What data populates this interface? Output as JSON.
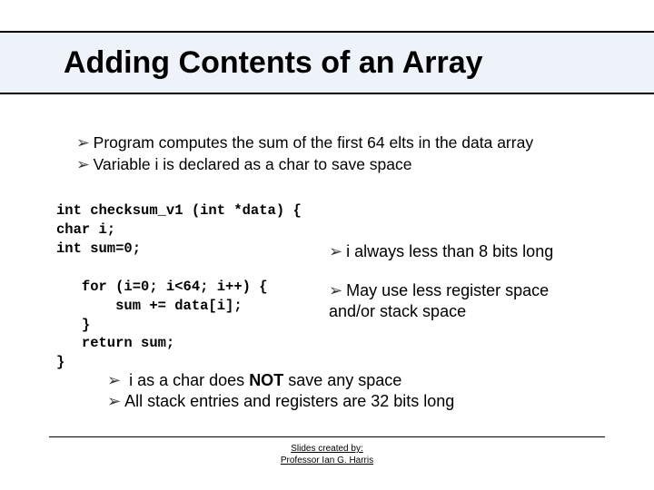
{
  "title": "Adding Contents of an Array",
  "bullets_top": [
    "Program computes the sum of the first 64 elts in the data array",
    "Variable i is declared as a char to save space"
  ],
  "code": "int checksum_v1 (int *data) {\nchar i;\nint sum=0;\n\n   for (i=0; i<64; i++) {\n       sum += data[i];\n   }\n   return sum;\n}",
  "right_notes": {
    "n1": "i always less than 8 bits long",
    "n2a": "May use less register space",
    "n2b": "and/or stack space"
  },
  "bullets_bottom": {
    "b1_pre": "i as a char does ",
    "b1_bold": "NOT",
    "b1_post": " save any space",
    "b2": "All stack entries and registers are 32 bits long"
  },
  "footer": {
    "l1": "Slides created by: ",
    "l2": "Professor Ian G. Harris "
  }
}
